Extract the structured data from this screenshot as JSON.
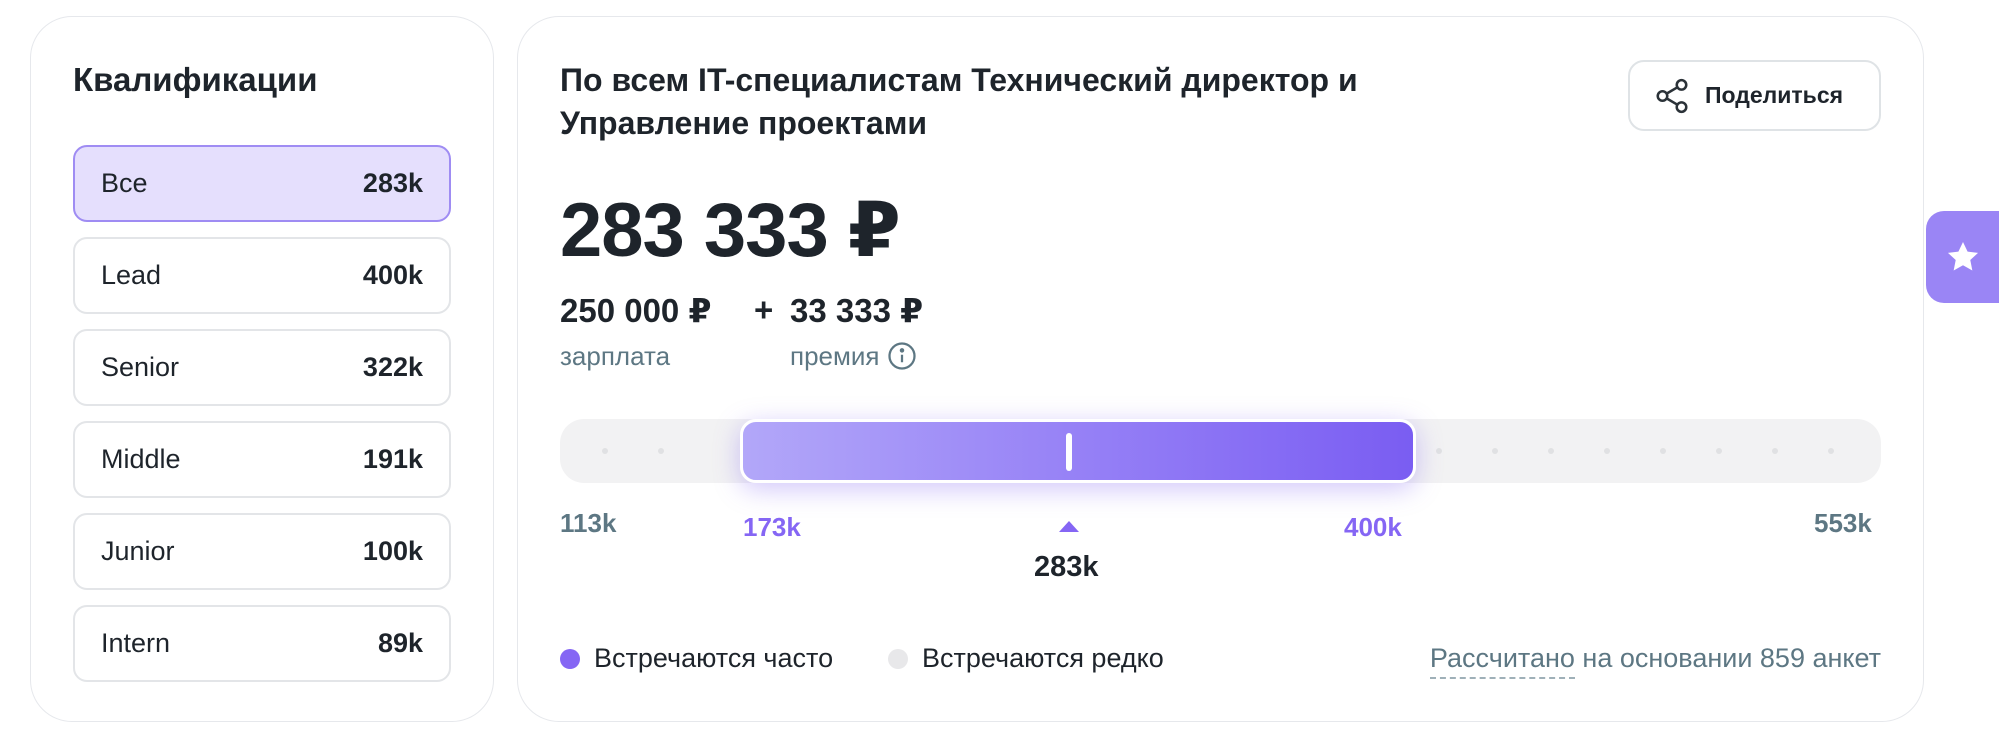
{
  "qualifications": {
    "title": "Квалификации",
    "items": [
      {
        "name": "Все",
        "value": "283k",
        "active": true
      },
      {
        "name": "Lead",
        "value": "400k"
      },
      {
        "name": "Senior",
        "value": "322k"
      },
      {
        "name": "Middle",
        "value": "191k"
      },
      {
        "name": "Junior",
        "value": "100k"
      },
      {
        "name": "Intern",
        "value": "89k"
      }
    ]
  },
  "main": {
    "title": "По всем IT-специалистам Технический директор и Управление проектами",
    "share_label": "Поделиться",
    "total": "283 333 ₽",
    "salary": "250 000 ₽",
    "plus": "+",
    "bonus": "33 333 ₽",
    "salary_label": "зарплата",
    "bonus_label": "премия",
    "scale": {
      "min": "113k",
      "range_low": "173k",
      "range_high": "400k",
      "max": "553k",
      "median": "283k"
    },
    "legend": {
      "often": "Встречаются часто",
      "rare": "Встречаются редко"
    },
    "source_link": "Рассчитано",
    "source_rest": " на основании 859 анкет"
  },
  "colors": {
    "accent": "#8566f4",
    "active_bg": "#e5dffd",
    "muted_text": "#5d7783",
    "rare_dot": "#e8e8ea"
  },
  "icons": {
    "share": "share-icon",
    "info": "info-icon",
    "favorite": "star-icon"
  }
}
